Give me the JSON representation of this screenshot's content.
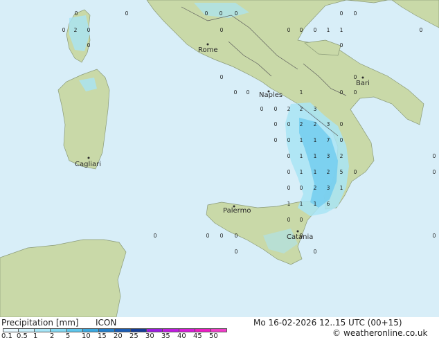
{
  "map": {
    "cities": [
      {
        "name": "Rome"
      },
      {
        "name": "Naples"
      },
      {
        "name": "Bari"
      },
      {
        "name": "Cagliari"
      },
      {
        "name": "Palermo"
      },
      {
        "name": "Catania"
      }
    ],
    "value_labels": [
      "0",
      "2",
      "1",
      "3",
      "7",
      "5",
      "6"
    ]
  },
  "footer": {
    "title": "Precipitation [mm]",
    "model": "ICON",
    "datetime": "Mo 16-02-2026 12..15 UTC (00+15)",
    "credit": "weatheronline.co.uk",
    "copyright_symbol": "©",
    "scale_labels": [
      "0.1",
      "0.5",
      "1",
      "2",
      "5",
      "10",
      "15",
      "20",
      "25",
      "30",
      "35",
      "40",
      "45",
      "50"
    ],
    "scale_colors": [
      "#e6f8ff",
      "#c8f0fc",
      "#a6e6f8",
      "#82d8f2",
      "#5ec6ec",
      "#3aa8e0",
      "#2480cc",
      "#1a5cb4",
      "#143c96",
      "#9c1ce0",
      "#c01ce0",
      "#d81cd8",
      "#ec1cc4",
      "#f03cc8"
    ]
  },
  "colors": {
    "sea": "#d8eef8",
    "land": "#c9d9a8",
    "precip_light": "#a9e4f5",
    "precip_mid": "#73cdee"
  }
}
